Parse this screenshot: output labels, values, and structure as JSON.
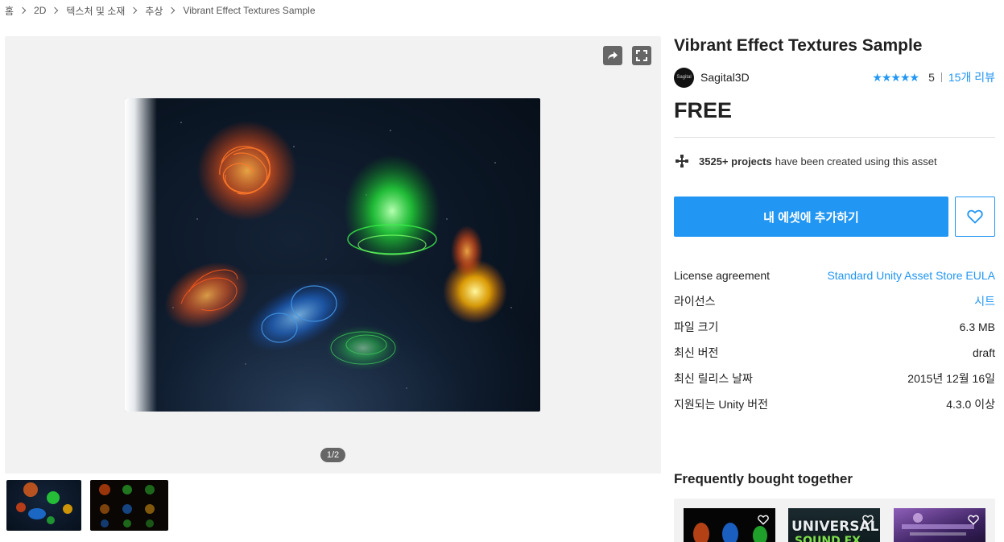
{
  "breadcrumb": [
    {
      "label": "홈"
    },
    {
      "label": "2D"
    },
    {
      "label": "텍스처 및 소재"
    },
    {
      "label": "추상"
    },
    {
      "label": "Vibrant Effect Textures Sample"
    }
  ],
  "gallery": {
    "counter": "1/2",
    "share_icon": "share-icon",
    "fullscreen_icon": "fullscreen-icon"
  },
  "product": {
    "title": "Vibrant Effect Textures Sample",
    "publisher": "Sagital3D",
    "avatar_text": "Sagital",
    "stars": "★★★★★",
    "rating": "5",
    "reviews": "15개 리뷰",
    "price": "FREE",
    "projects_bold": "3525+ projects",
    "projects_rest": "have been created using this asset",
    "add_button": "내 에셋에 추가하기"
  },
  "info": [
    {
      "key": "License agreement",
      "value": "Standard Unity Asset Store EULA",
      "link": true
    },
    {
      "key": "라이선스",
      "value": "시트",
      "link": true
    },
    {
      "key": "파일 크기",
      "value": "6.3 MB",
      "link": false
    },
    {
      "key": "최신 버전",
      "value": "draft",
      "link": false
    },
    {
      "key": "최신 릴리스 날짜",
      "value": "2015년 12월 16일",
      "link": false
    },
    {
      "key": "지원되는 Unity 버전",
      "value": "4.3.0 이상",
      "link": false
    }
  ],
  "fbt": {
    "title": "Frequently bought together",
    "card2_text_1": "UNIVERSAL",
    "card2_text_2": "SOUND FX"
  },
  "colors": {
    "accent": "#2196f3",
    "text": "#212121",
    "gallery_bg": "#f2f2f2"
  }
}
